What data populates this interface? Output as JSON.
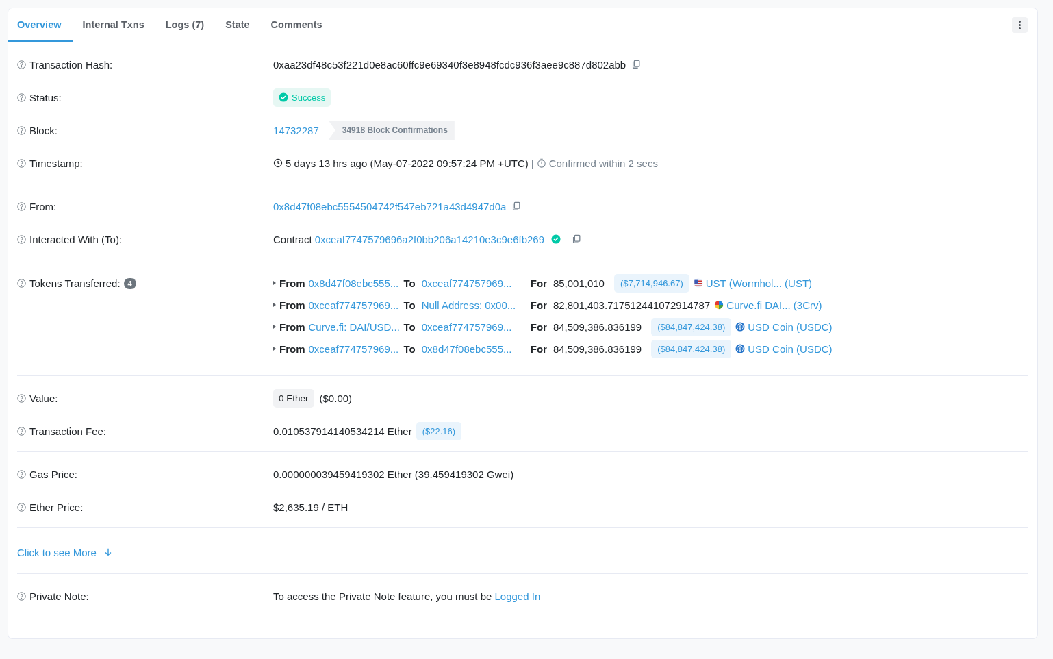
{
  "tabs": [
    {
      "label": "Overview",
      "selected": true
    },
    {
      "label": "Internal Txns",
      "selected": false
    },
    {
      "label": "Logs (7)",
      "selected": false
    },
    {
      "label": "State",
      "selected": false
    },
    {
      "label": "Comments",
      "selected": false
    }
  ],
  "sections": [
    {
      "rows": [
        {
          "label": "Transaction Hash:",
          "kind": "hash",
          "value": "0xaa23df48c53f221d0e8ac60ffc9e69340f3e8948fcdc936f3aee9c887d802abb"
        },
        {
          "label": "Status:",
          "kind": "status",
          "value": "Success"
        },
        {
          "label": "Block:",
          "kind": "block",
          "block": "14732287",
          "confirmations": "34918 Block Confirmations"
        },
        {
          "label": "Timestamp:",
          "kind": "timestamp",
          "age": "5 days 13 hrs ago (May-07-2022 09:57:24 PM +UTC)",
          "separator": "|",
          "confirmed": "Confirmed within 2 secs"
        }
      ]
    },
    {
      "rows": [
        {
          "label": "From:",
          "kind": "address",
          "value": "0x8d47f08ebc5554504742f547eb721a43d4947d0a"
        },
        {
          "label": "Interacted With (To):",
          "kind": "contract",
          "prefix": "Contract",
          "address": "0xceaf7747579696a2f0bb206a14210e3c9e6fb269",
          "verified": true
        }
      ]
    },
    {
      "rows": [
        {
          "label": "Tokens Transferred:",
          "count": "4",
          "kind": "tokens",
          "transfers": [
            {
              "from_label": "From",
              "from": "0x8d47f08ebc555...",
              "to_label": "To",
              "to": "0xceaf774757969...",
              "for_label": "For",
              "amount": "85,001,010",
              "usd": "($7,714,946.67)",
              "kind": "flag",
              "token": "UST (Wormhol... (UST)"
            },
            {
              "from_label": "From",
              "from": "0xceaf774757969...",
              "to_label": "To",
              "to": "Null Address: 0x00...",
              "for_label": "For",
              "amount": "82,801,403.717512441072914787",
              "kind": "rainbow",
              "token": "Curve.fi DAI... (3Crv)"
            },
            {
              "from_label": "From",
              "from": "Curve.fi: DAI/USD...",
              "to_label": "To",
              "to": "0xceaf774757969...",
              "for_label": "For",
              "amount": "84,509,386.836199",
              "usd": "($84,847,424.38)",
              "kind": "coin",
              "token": "USD Coin (USDC)"
            },
            {
              "from_label": "From",
              "from": "0xceaf774757969...",
              "to_label": "To",
              "to": "0x8d47f08ebc555...",
              "for_label": "For",
              "amount": "84,509,386.836199",
              "usd": "($84,847,424.38)",
              "kind": "coin",
              "token": "USD Coin (USDC)"
            }
          ]
        }
      ]
    },
    {
      "rows": [
        {
          "label": "Value:",
          "kind": "value",
          "amount": "0 Ether",
          "usd": "($0.00)"
        },
        {
          "label": "Transaction Fee:",
          "kind": "fee",
          "amount": "0.010537914140534214 Ether",
          "usd": "($22.16)"
        }
      ]
    },
    {
      "rows": [
        {
          "label": "Gas Price:",
          "kind": "text",
          "value": "0.000000039459419302 Ether (39.459419302 Gwei)"
        },
        {
          "label": "Ether Price:",
          "kind": "text",
          "value": "$2,635.19 / ETH"
        }
      ]
    },
    {
      "more": "Click to see More"
    },
    {
      "rows": [
        {
          "label": "Private Note:",
          "kind": "note",
          "text": "To access the Private Note feature, you must be",
          "link": "Logged In"
        }
      ]
    }
  ]
}
